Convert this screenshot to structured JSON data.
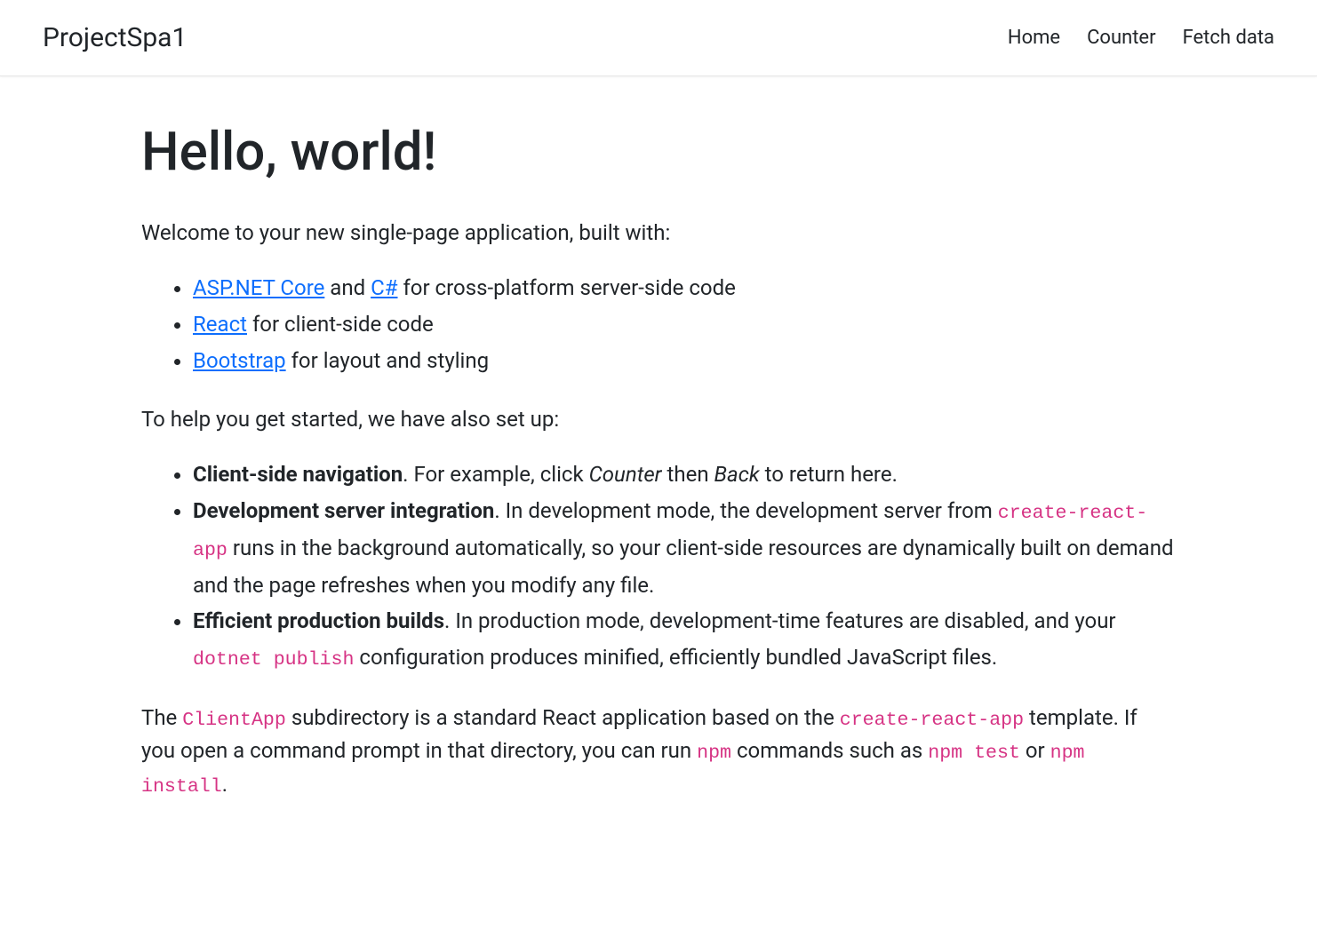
{
  "navbar": {
    "brand": "ProjectSpa1",
    "links": [
      "Home",
      "Counter",
      "Fetch data"
    ]
  },
  "main": {
    "heading": "Hello, world!",
    "intro": "Welcome to your new single-page application, built with:",
    "stack": {
      "item1_link1": "ASP.NET Core",
      "item1_mid": " and ",
      "item1_link2": "C#",
      "item1_suffix": " for cross-platform server-side code",
      "item2_link": "React",
      "item2_suffix": " for client-side code",
      "item3_link": "Bootstrap",
      "item3_suffix": " for layout and styling"
    },
    "setup_intro": "To help you get started, we have also set up:",
    "features": {
      "f1_strong": "Client-side navigation",
      "f1_t1": ". For example, click ",
      "f1_em1": "Counter",
      "f1_t2": " then ",
      "f1_em2": "Back",
      "f1_t3": " to return here.",
      "f2_strong": "Development server integration",
      "f2_t1": ". In development mode, the development server from ",
      "f2_code": "create-react-app",
      "f2_t2": " runs in the background automatically, so your client-side resources are dynamically built on demand and the page refreshes when you modify any file.",
      "f3_strong": "Efficient production builds",
      "f3_t1": ". In production mode, development-time features are disabled, and your ",
      "f3_code": "dotnet publish",
      "f3_t2": " configuration produces minified, efficiently bundled JavaScript files."
    },
    "footer": {
      "t1": "The ",
      "code1": "ClientApp",
      "t2": " subdirectory is a standard React application based on the ",
      "code2": "create-react-app",
      "t3": " template. If you open a command prompt in that directory, you can run ",
      "code3": "npm",
      "t4": " commands such as ",
      "code4": "npm test",
      "t5": " or ",
      "code5": "npm install",
      "t6": "."
    }
  }
}
